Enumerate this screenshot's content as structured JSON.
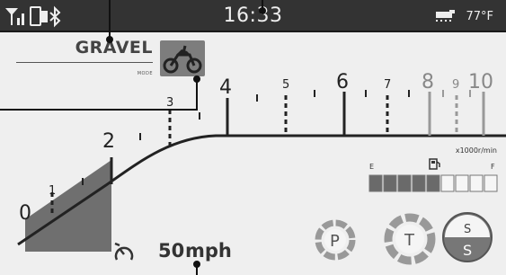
{
  "status_bar": {
    "clock": "16:33",
    "temperature": "77°F",
    "icons": [
      "signal-icon",
      "phone-battery-icon",
      "bluetooth-icon",
      "heated-grip-icon"
    ]
  },
  "riding_mode": {
    "label": "GRAVEL",
    "sublabel": "MODE",
    "icon": "adventure-motorcycle-icon"
  },
  "tachometer": {
    "scale_labels": [
      "0",
      "1",
      "2",
      "3",
      "4",
      "5",
      "6",
      "7",
      "8",
      "9",
      "10"
    ],
    "unit": "x1000r/min"
  },
  "fuel_gauge": {
    "empty_label": "E",
    "full_label": "F",
    "segments_total": 9,
    "segments_filled": 5,
    "icon": "fuel-pump-icon"
  },
  "speed": {
    "value": "50",
    "unit": "mph",
    "icon": "speedometer-icon"
  },
  "mode_indicators": {
    "power": "P",
    "traction": "T",
    "suspension_upper": "S",
    "suspension_lower": "S"
  },
  "colors": {
    "background": "#efefef",
    "status_bar": "#333333",
    "accent_gray": "#7d7d7d"
  }
}
